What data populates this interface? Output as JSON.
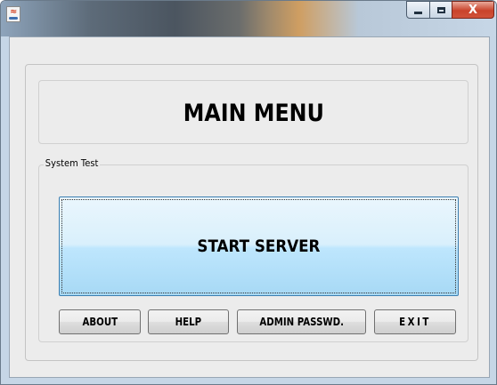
{
  "window": {
    "icon": "java-cup-icon",
    "controls": [
      "minimize-icon",
      "maximize-icon",
      "close-icon"
    ],
    "close_glyph": "X"
  },
  "main": {
    "title": "MAIN MENU",
    "group_label": "System Test",
    "start_label": "START SERVER",
    "buttons": {
      "about": "ABOUT",
      "help": "HELP",
      "admin": "ADMIN PASSWD.",
      "exit": "EXIT"
    }
  },
  "colors": {
    "close_button": "#c9432b",
    "start_button_top": "#eaf6fd",
    "start_button_bottom": "#a7d9f5"
  }
}
